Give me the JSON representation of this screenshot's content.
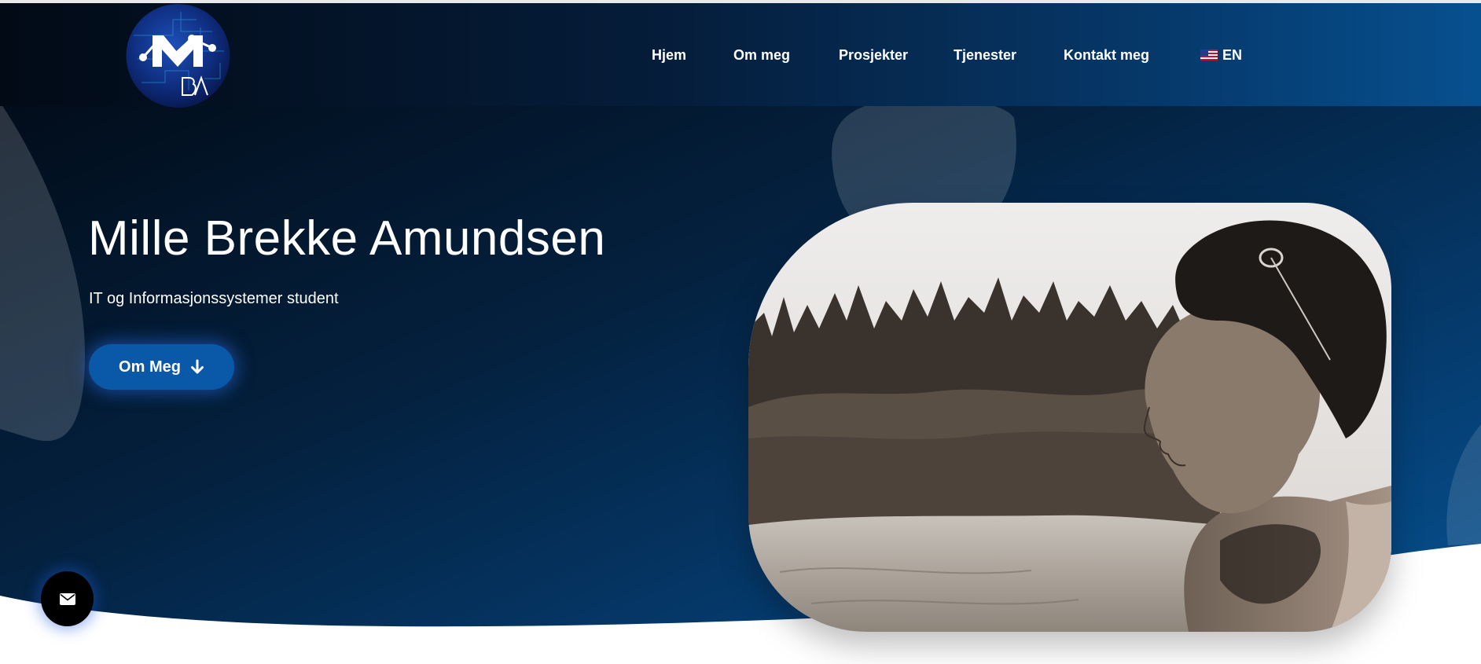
{
  "site": {
    "logo_icon": "mba-logo-icon"
  },
  "nav": {
    "items": [
      {
        "label": "Hjem"
      },
      {
        "label": "Om meg"
      },
      {
        "label": "Prosjekter"
      },
      {
        "label": "Tjenester"
      },
      {
        "label": "Kontakt meg"
      }
    ],
    "language": {
      "label": "EN",
      "flag_icon": "us-flag-icon"
    }
  },
  "hero": {
    "title": "Mille Brekke Amundsen",
    "subtitle": "IT og Informasjonssystemer student",
    "cta": {
      "label": "Om Meg",
      "icon": "arrow-down-icon"
    },
    "portrait_icon": "portrait-photo"
  },
  "floating": {
    "mail_icon": "envelope-icon"
  },
  "colors": {
    "background_dark": "#020a16",
    "background_blue": "#07508f",
    "button_blue": "#0a58a8",
    "text": "#ffffff",
    "mail_button": "#000000"
  }
}
